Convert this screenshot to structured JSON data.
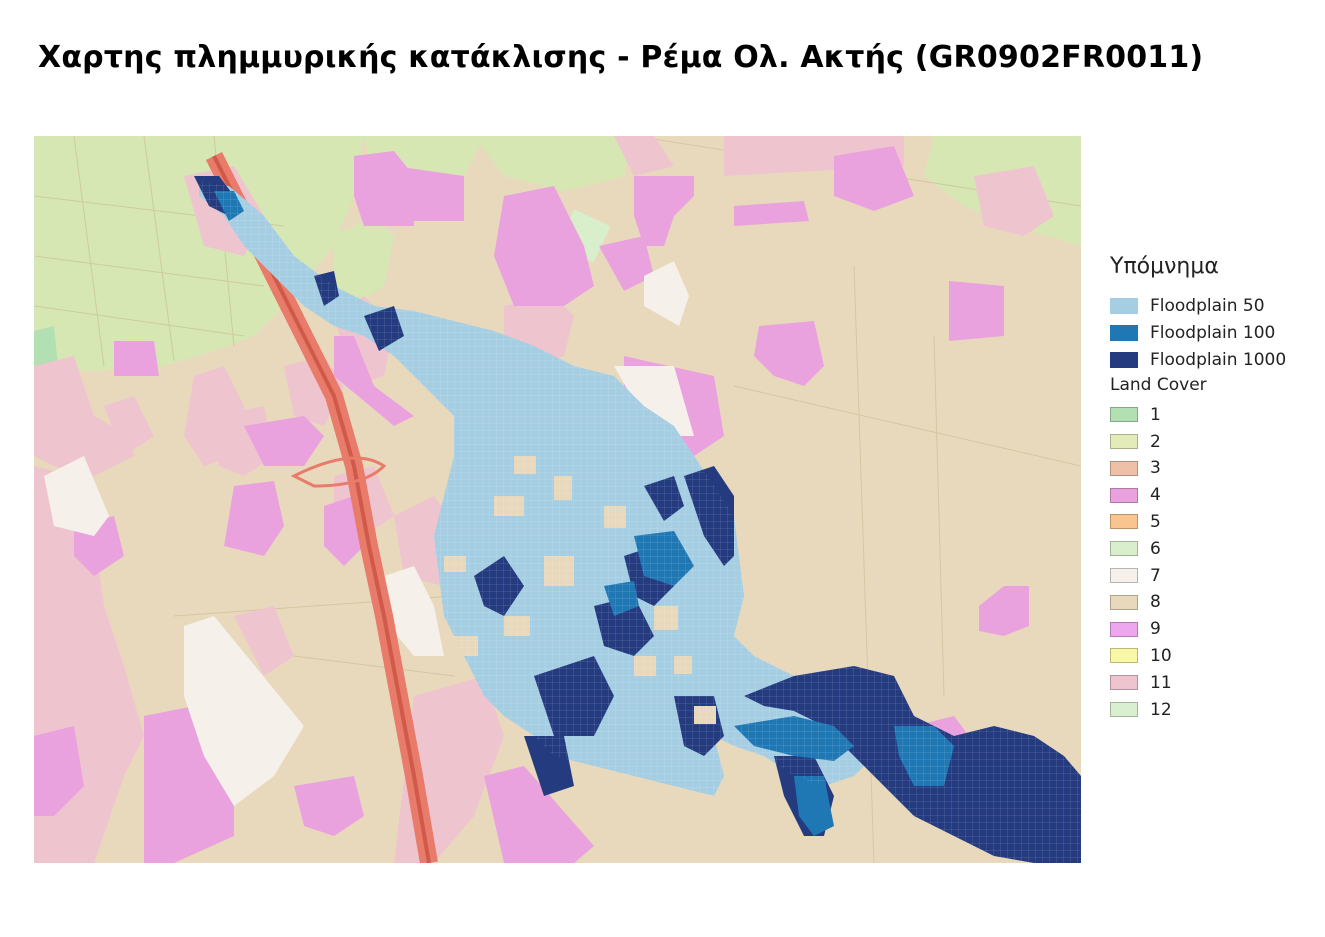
{
  "title": "Χαρτης πλημμυρικής κατάκλισης - Ρέμα Ολ. Ακτής (GR0902FR0011)",
  "legend": {
    "title": "Υπόμνημα",
    "floodplains": [
      {
        "label": "Floodplain 50",
        "color": "#a6cee3"
      },
      {
        "label": "Floodplain 100",
        "color": "#1f78b4"
      },
      {
        "label": "Floodplain 1000",
        "color": "#253b80"
      }
    ],
    "land_cover_title": "Land Cover",
    "land_cover": [
      {
        "label": "1",
        "color": "#b3e0b3"
      },
      {
        "label": "2",
        "color": "#e3ebb8"
      },
      {
        "label": "3",
        "color": "#efbfa8"
      },
      {
        "label": "4",
        "color": "#eaa2de"
      },
      {
        "label": "5",
        "color": "#f9c490"
      },
      {
        "label": "6",
        "color": "#d9efcc"
      },
      {
        "label": "7",
        "color": "#f6f0ea"
      },
      {
        "label": "8",
        "color": "#e8d9bd"
      },
      {
        "label": "9",
        "color": "#eea7ef"
      },
      {
        "label": "10",
        "color": "#f8f7a5"
      },
      {
        "label": "11",
        "color": "#eec4cf"
      },
      {
        "label": "12",
        "color": "#d9efd0"
      }
    ]
  },
  "map": {
    "colors": {
      "base": "#e8d9bd",
      "green_urban": "#d6e7b4",
      "road": "#e87b6a",
      "road_core": "#d05a4a"
    }
  }
}
